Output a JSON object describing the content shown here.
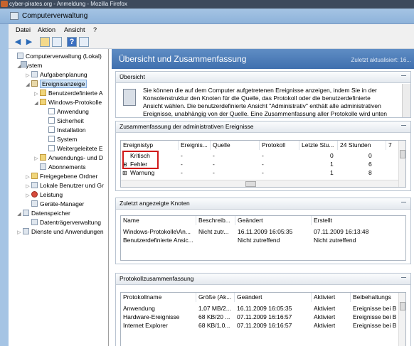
{
  "browser_title": "cyber-pirates.org - Anmeldung - Mozilla Firefox",
  "window": {
    "title": "Computerverwaltung"
  },
  "menu": [
    "Datei",
    "Aktion",
    "Ansicht",
    "?"
  ],
  "toolbar_icons": [
    "back-arrow-icon",
    "forward-arrow-icon",
    "up-folder-icon",
    "show-hide-tree-icon",
    "help-icon",
    "properties-icon"
  ],
  "tree": [
    {
      "label": "Computerverwaltung (Lokal)"
    },
    {
      "label": "System"
    },
    {
      "label": "Aufgabenplanung"
    },
    {
      "label": "Ereignisanzeige"
    },
    {
      "label": "Benutzerdefinierte A"
    },
    {
      "label": "Windows-Protokolle"
    },
    {
      "label": "Anwendung"
    },
    {
      "label": "Sicherheit"
    },
    {
      "label": "Installation"
    },
    {
      "label": "System"
    },
    {
      "label": "Weitergeleitete E"
    },
    {
      "label": "Anwendungs- und D"
    },
    {
      "label": "Abonnements"
    },
    {
      "label": "Freigegebene Ordner"
    },
    {
      "label": "Lokale Benutzer und Gr"
    },
    {
      "label": "Leistung"
    },
    {
      "label": "Geräte-Manager"
    },
    {
      "label": "Datenspeicher"
    },
    {
      "label": "Datenträgerverwaltung"
    },
    {
      "label": "Dienste und Anwendungen"
    }
  ],
  "main": {
    "title": "Übersicht und Zusammenfassung",
    "updated": "Zuletzt aktualisiert: 16...",
    "overview": {
      "header": "Übersicht",
      "lines": [
        "Sie können die auf dem Computer aufgetretenen Ereignisse anzeigen, indem Sie in der",
        "Konsolenstruktur den Knoten für die Quelle, das Protokoll oder die benutzerdefinierte",
        "Ansicht wählen. Die benutzerdefinierte Ansicht \"Administrativ\" enthält alle administrativen",
        "Ereignisse, unabhängig von der Quelle. Eine Zusammenfassung aller Protokolle wird unten"
      ]
    },
    "admin_summary": {
      "header": "Zusammenfassung der administrativen Ereignisse",
      "columns": [
        "Ereignistyp",
        "Ereignis...",
        "Quelle",
        "Protokoll",
        "Letzte Stu...",
        "24 Stunden",
        "7"
      ],
      "rows": [
        [
          "Kritisch",
          "-",
          "-",
          "-",
          "0",
          "0"
        ],
        [
          "Fehler",
          "-",
          "-",
          "-",
          "1",
          "6"
        ],
        [
          "Warnung",
          "-",
          "-",
          "-",
          "1",
          "8"
        ]
      ]
    },
    "recent_nodes": {
      "header": "Zuletzt angezeigte Knoten",
      "columns": [
        "Name",
        "Beschreib...",
        "Geändert",
        "Erstellt"
      ],
      "rows": [
        [
          "Windows-Protokolle\\An...",
          "Nicht zutr...",
          "16.11.2009 16:05:35",
          "07.11.2009 16:13:48"
        ],
        [
          "Benutzerdefinierte Ansic...",
          "",
          "Nicht zutreffend",
          "Nicht zutreffend"
        ]
      ]
    },
    "log_summary": {
      "header": "Protokollzusammenfassung",
      "columns": [
        "Protokollname",
        "Größe (Ak...",
        "Geändert",
        "Aktiviert",
        "Beibehaltungs"
      ],
      "rows": [
        [
          "Anwendung",
          "1,07 MB/2...",
          "16.11.2009 16:05:35",
          "Aktiviert",
          "Ereignisse bei B"
        ],
        [
          "Hardware-Ereignisse",
          "68 KB/20 ...",
          "07.11.2009 16:16:57",
          "Aktiviert",
          "Ereignisse bei B"
        ],
        [
          "Internet Explorer",
          "68 KB/1,0...",
          "07.11.2009 16:16:57",
          "Aktiviert",
          "Ereignisse bei B"
        ]
      ]
    }
  }
}
